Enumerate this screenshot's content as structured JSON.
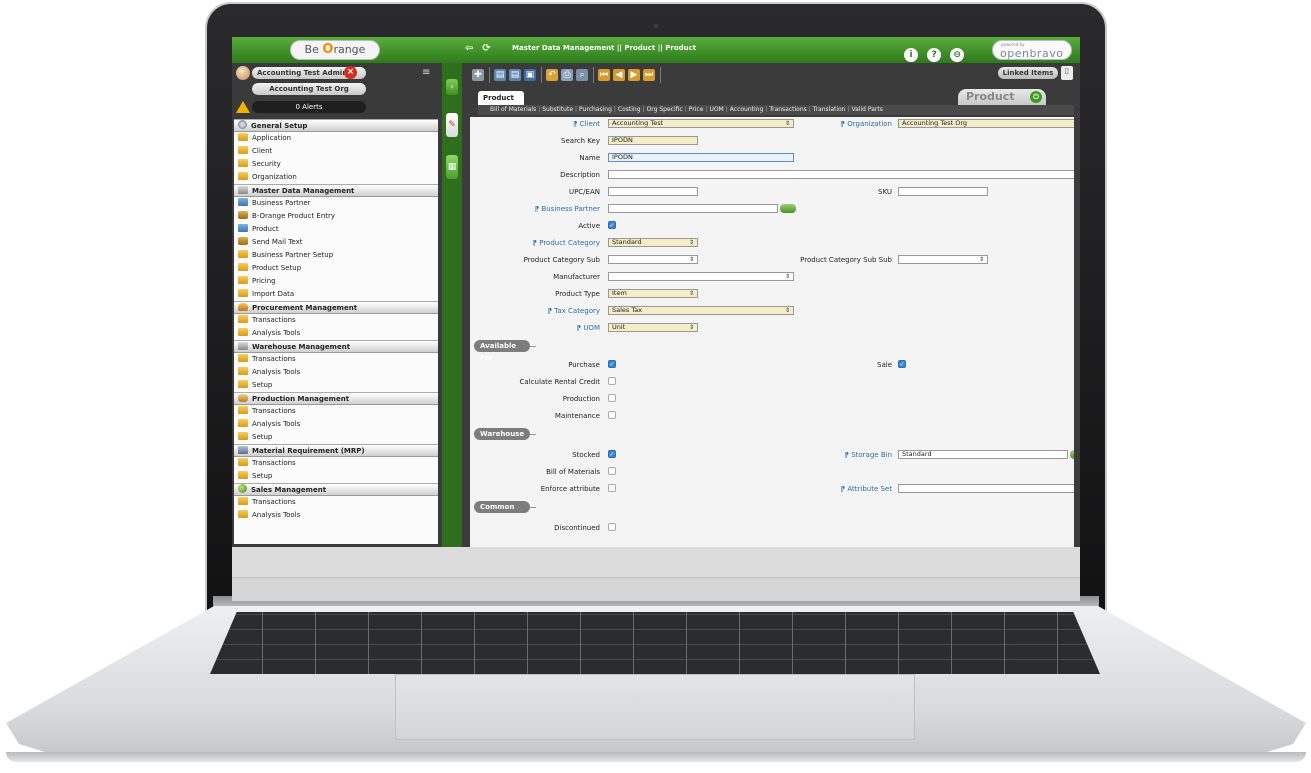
{
  "header": {
    "logo_left_prefix": "Be",
    "logo_left_o": "O",
    "logo_left_suffix": "range",
    "title": "Master Data Management || Product || Product",
    "icons": [
      "info-icon",
      "help-icon",
      "logout-icon"
    ],
    "powered_by": "powered by",
    "logo_right": "openbravo"
  },
  "user": {
    "role": "Accounting Test Admin",
    "org": "Accounting Test Org",
    "alerts": "0  Alerts"
  },
  "menu": [
    {
      "type": "section",
      "label": "General Setup",
      "icon": "gear"
    },
    {
      "type": "item",
      "label": "Application",
      "icon": "folder"
    },
    {
      "type": "item",
      "label": "Client",
      "icon": "folder"
    },
    {
      "type": "item",
      "label": "Security",
      "icon": "folder"
    },
    {
      "type": "item",
      "label": "Organization",
      "icon": "folder"
    },
    {
      "type": "section",
      "label": "Master Data Management",
      "icon": "box"
    },
    {
      "type": "item",
      "label": "Business Partner",
      "icon": "doc"
    },
    {
      "type": "item",
      "label": "B-Orange Product Entry",
      "icon": "puzzle"
    },
    {
      "type": "item",
      "label": "Product",
      "icon": "doc"
    },
    {
      "type": "item",
      "label": "Send Mail Text",
      "icon": "puzzle"
    },
    {
      "type": "item",
      "label": "Business Partner Setup",
      "icon": "folder"
    },
    {
      "type": "item",
      "label": "Product Setup",
      "icon": "folder"
    },
    {
      "type": "item",
      "label": "Pricing",
      "icon": "folder"
    },
    {
      "type": "item",
      "label": "Import Data",
      "icon": "folder"
    },
    {
      "type": "section",
      "label": "Procurement Management",
      "icon": "cart"
    },
    {
      "type": "item",
      "label": "Transactions",
      "icon": "folder"
    },
    {
      "type": "item",
      "label": "Analysis Tools",
      "icon": "folder"
    },
    {
      "type": "section",
      "label": "Warehouse Management",
      "icon": "box"
    },
    {
      "type": "item",
      "label": "Transactions",
      "icon": "folder"
    },
    {
      "type": "item",
      "label": "Analysis Tools",
      "icon": "folder"
    },
    {
      "type": "item",
      "label": "Setup",
      "icon": "folder"
    },
    {
      "type": "section",
      "label": "Production Management",
      "icon": "factory"
    },
    {
      "type": "item",
      "label": "Transactions",
      "icon": "folder"
    },
    {
      "type": "item",
      "label": "Analysis Tools",
      "icon": "folder"
    },
    {
      "type": "item",
      "label": "Setup",
      "icon": "folder"
    },
    {
      "type": "section",
      "label": "Material Requirement (MRP)",
      "icon": "chart"
    },
    {
      "type": "item",
      "label": "Transactions",
      "icon": "folder"
    },
    {
      "type": "item",
      "label": "Setup",
      "icon": "folder"
    },
    {
      "type": "section",
      "label": "Sales Management",
      "icon": "globe"
    },
    {
      "type": "item",
      "label": "Transactions",
      "icon": "folder"
    },
    {
      "type": "item",
      "label": "Analysis Tools",
      "icon": "folder"
    }
  ],
  "toolbar": {
    "linked_items": "Linked Items"
  },
  "tabs": {
    "active": "Product",
    "window_title": "Product"
  },
  "subtabs": [
    "Bill of Materials",
    "Substitute",
    "Purchasing",
    "Costing",
    "Org Specific",
    "Price",
    "UOM",
    "Accounting",
    "Transactions",
    "Translation",
    "Valid Parts"
  ],
  "form": {
    "client": {
      "label": "Client",
      "value": "Accounting Test"
    },
    "organization": {
      "label": "Organization",
      "value": "Accounting Test Org"
    },
    "search_key": {
      "label": "Search Key",
      "value": "IPODN"
    },
    "name": {
      "label": "Name",
      "value": "IPODN"
    },
    "description": {
      "label": "Description",
      "value": ""
    },
    "upc": {
      "label": "UPC/EAN",
      "value": ""
    },
    "sku": {
      "label": "SKU",
      "value": ""
    },
    "business_partner": {
      "label": "Business Partner",
      "value": ""
    },
    "active": {
      "label": "Active",
      "checked": true
    },
    "product_category": {
      "label": "Product Category",
      "value": "Standard"
    },
    "product_category_sub": {
      "label": "Product Category Sub",
      "value": ""
    },
    "product_category_sub_sub": {
      "label": "Product Category Sub Sub",
      "value": ""
    },
    "manufacturer": {
      "label": "Manufacturer",
      "value": ""
    },
    "product_type": {
      "label": "Product Type",
      "value": "Item"
    },
    "tax_category": {
      "label": "Tax Category",
      "value": "Sales Tax"
    },
    "uom": {
      "label": "UOM",
      "value": "Unit"
    },
    "available_for": "Available For",
    "purchase": {
      "label": "Purchase",
      "checked": true
    },
    "sale": {
      "label": "Sale",
      "checked": true
    },
    "rental_credit": {
      "label": "Calculate Rental Credit",
      "checked": false
    },
    "production": {
      "label": "Production",
      "checked": false
    },
    "maintenance": {
      "label": "Maintenance",
      "checked": false
    },
    "warehouse": "Warehouse",
    "stocked": {
      "label": "Stocked",
      "checked": true
    },
    "storage_bin": {
      "label": "Storage Bin",
      "value": "Standard"
    },
    "bill_of_materials": {
      "label": "Bill of Materials",
      "checked": false
    },
    "enforce_attribute": {
      "label": "Enforce attribute",
      "checked": false
    },
    "attribute_set": {
      "label": "Attribute Set",
      "value": ""
    },
    "common": "Common",
    "discontinued": {
      "label": "Discontinued",
      "checked": false
    }
  }
}
